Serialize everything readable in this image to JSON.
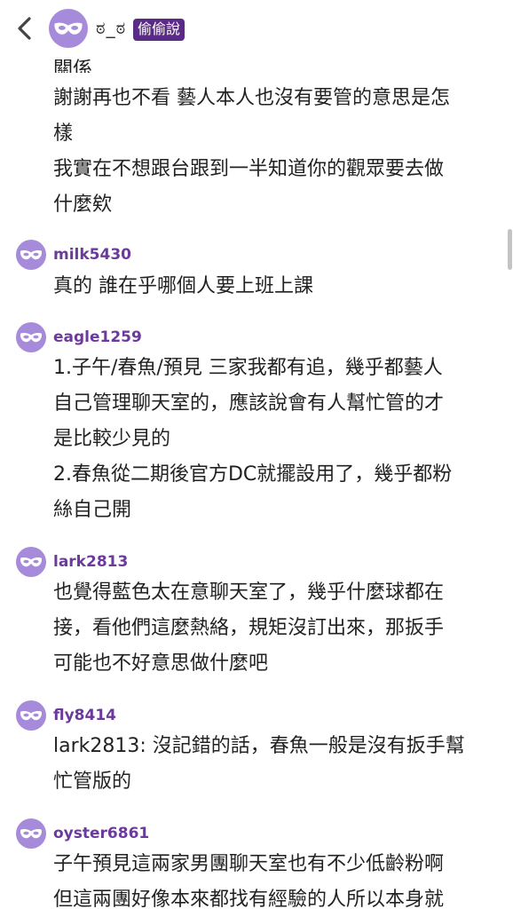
{
  "header": {
    "back_icon": "chevron-left-icon",
    "name": "ಠ_ಠ",
    "badge": "偷偷說"
  },
  "colors": {
    "avatar_bg": "#a78bdb",
    "username": "#6c3a9c",
    "badge_bg": "#5b2a86"
  },
  "top_post": {
    "clipped_text": "關係",
    "lines": [
      "謝謝再也不看 藝人本人也沒有要管的意思是怎",
      "樣",
      "我實在不想跟台跟到一半知道你的觀眾要去做",
      "什麼欸"
    ]
  },
  "comments": [
    {
      "username": "milk5430",
      "lines": [
        "真的 誰在乎哪個人要上班上課"
      ]
    },
    {
      "username": "eagle1259",
      "lines": [
        "1.子午/春魚/預見 三家我都有追，幾乎都藝人",
        "自己管理聊天室的，應該說會有人幫忙管的才",
        "是比較少見的",
        "2.春魚從二期後官方DC就擺設用了，幾乎都粉",
        "絲自己開"
      ]
    },
    {
      "username": "lark2813",
      "lines": [
        "也覺得藍色太在意聊天室了，幾乎什麼球都在",
        "接，看他們這麼熱絡，規矩沒訂出來，那扳手",
        "可能也不好意思做什麼吧"
      ]
    },
    {
      "username": "fly8414",
      "lines": [
        "lark2813: 沒記錯的話，春魚一般是沒有扳手幫",
        "忙管版的"
      ]
    },
    {
      "username": "oyster6861",
      "lines": [
        "子午預見這兩家男團聊天室也有不少低齡粉啊",
        "但這兩團好像本來都找有經驗的人所以本身就"
      ]
    }
  ]
}
